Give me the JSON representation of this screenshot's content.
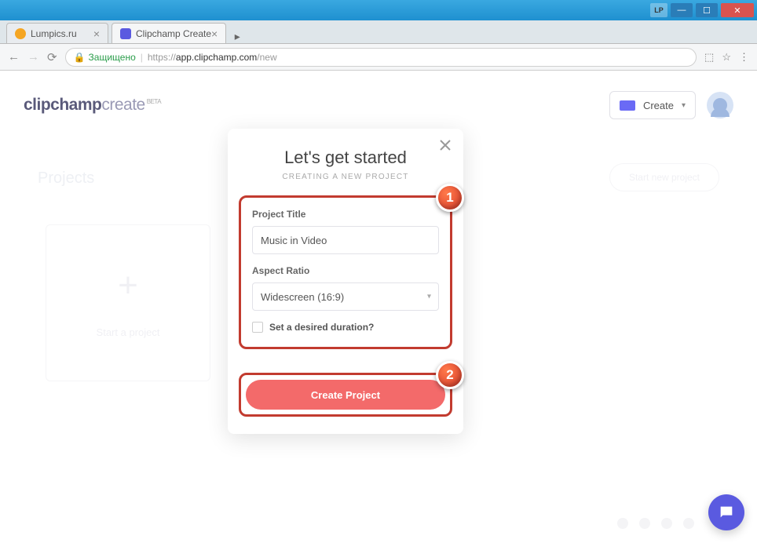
{
  "window": {
    "badge": "LP"
  },
  "tabs": [
    {
      "title": "Lumpics.ru",
      "favcolor": "#f5a623"
    },
    {
      "title": "Clipchamp Create",
      "favcolor": "#5a5ae0"
    }
  ],
  "addressbar": {
    "secure_label": "Защищено",
    "url_scheme": "https://",
    "url_host": "app.clipchamp.com",
    "url_path": "/new"
  },
  "header": {
    "logo_a": "clipchamp",
    "logo_b": "create",
    "beta": "BETA",
    "create_label": "Create"
  },
  "background": {
    "projects": "Projects",
    "start_btn": "Start new project",
    "card_text": "Start a project"
  },
  "modal": {
    "title": "Let's get started",
    "subtitle": "CREATING A NEW PROJECT",
    "label_title": "Project Title",
    "input_title_value": "Music in Video",
    "label_ratio": "Aspect Ratio",
    "ratio_value": "Widescreen (16:9)",
    "chk_label": "Set a desired duration?",
    "create_btn": "Create Project",
    "marker1": "1",
    "marker2": "2"
  },
  "footer": {
    "left": ""
  }
}
